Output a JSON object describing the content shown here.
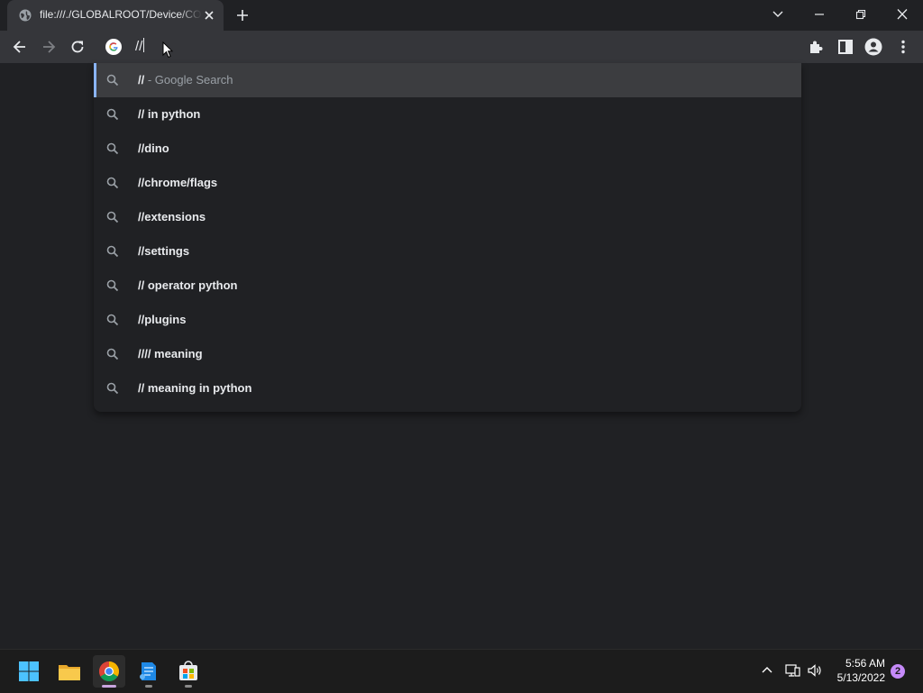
{
  "browser": {
    "tab_title": "file:///./GLOBALROOT/Device/CONDRV/KernelConnect",
    "omnibox_text": "//"
  },
  "icons": {
    "back": "arrow-left-icon",
    "forward": "arrow-right-icon",
    "reload": "reload-icon",
    "extensions": "puzzle-icon",
    "side_panel": "side-panel-icon",
    "profile": "person-icon",
    "menu": "kebab-menu-icon",
    "suggestion": "search-icon"
  },
  "suggestions": [
    {
      "text": "//",
      "description": "- Google Search"
    },
    {
      "text": "// in python",
      "description": ""
    },
    {
      "text": "//dino",
      "description": ""
    },
    {
      "text": "//chrome/flags",
      "description": ""
    },
    {
      "text": "//extensions",
      "description": ""
    },
    {
      "text": "//settings",
      "description": ""
    },
    {
      "text": "// operator python",
      "description": ""
    },
    {
      "text": "//plugins",
      "description": ""
    },
    {
      "text": "//// meaning",
      "description": ""
    },
    {
      "text": "// meaning in python",
      "description": ""
    }
  ],
  "taskbar": {
    "apps": [
      "start",
      "file-explorer",
      "chrome",
      "azure-data-studio",
      "microsoft-store"
    ],
    "clock_time": "5:56 AM",
    "clock_date": "5/13/2022",
    "notification_count": "2"
  },
  "colors": {
    "background": "#202124",
    "toolbar": "#35363a",
    "selected_row": "#3c3d40",
    "accent": "#8ab4f8"
  }
}
